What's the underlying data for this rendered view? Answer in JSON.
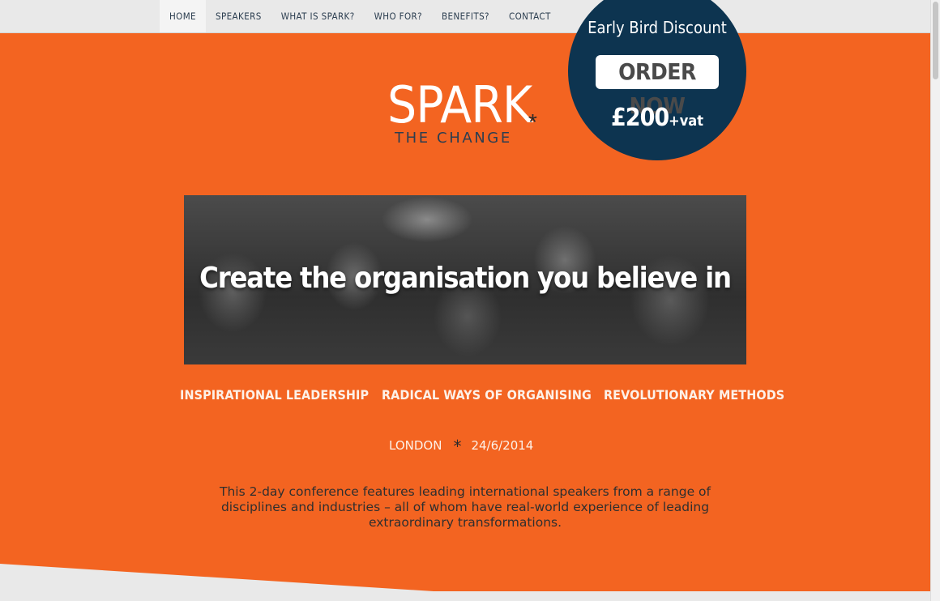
{
  "nav": {
    "items": [
      {
        "label": "HOME"
      },
      {
        "label": "SPEAKERS"
      },
      {
        "label": "WHAT IS SPARK?"
      },
      {
        "label": "WHO FOR?"
      },
      {
        "label": "BENEFITS?"
      },
      {
        "label": "CONTACT"
      }
    ],
    "active_index": 0
  },
  "logo": {
    "main": "SPARK",
    "star": "*",
    "subtitle": "THE CHANGE"
  },
  "promo": {
    "title": "Early Bird Discount",
    "button": "ORDER NOW",
    "price": "£200",
    "price_suffix": "+vat"
  },
  "banner": {
    "headline": "Create the organisation you believe in"
  },
  "features": [
    {
      "label": "INSPIRATIONAL LEADERSHIP"
    },
    {
      "label": "RADICAL WAYS OF ORGANISING"
    },
    {
      "label": "REVOLUTIONARY METHODS"
    }
  ],
  "event": {
    "city": "LONDON",
    "separator": "*",
    "date": "24/6/2014"
  },
  "description": "This 2-day conference features leading international speakers from a range of disciplines and industries – all of whom have real-world experience of leading extraordinary transformations.",
  "colors": {
    "brand_orange": "#f36421",
    "navy": "#0d3450",
    "nav_bg": "#e9e9e9"
  }
}
